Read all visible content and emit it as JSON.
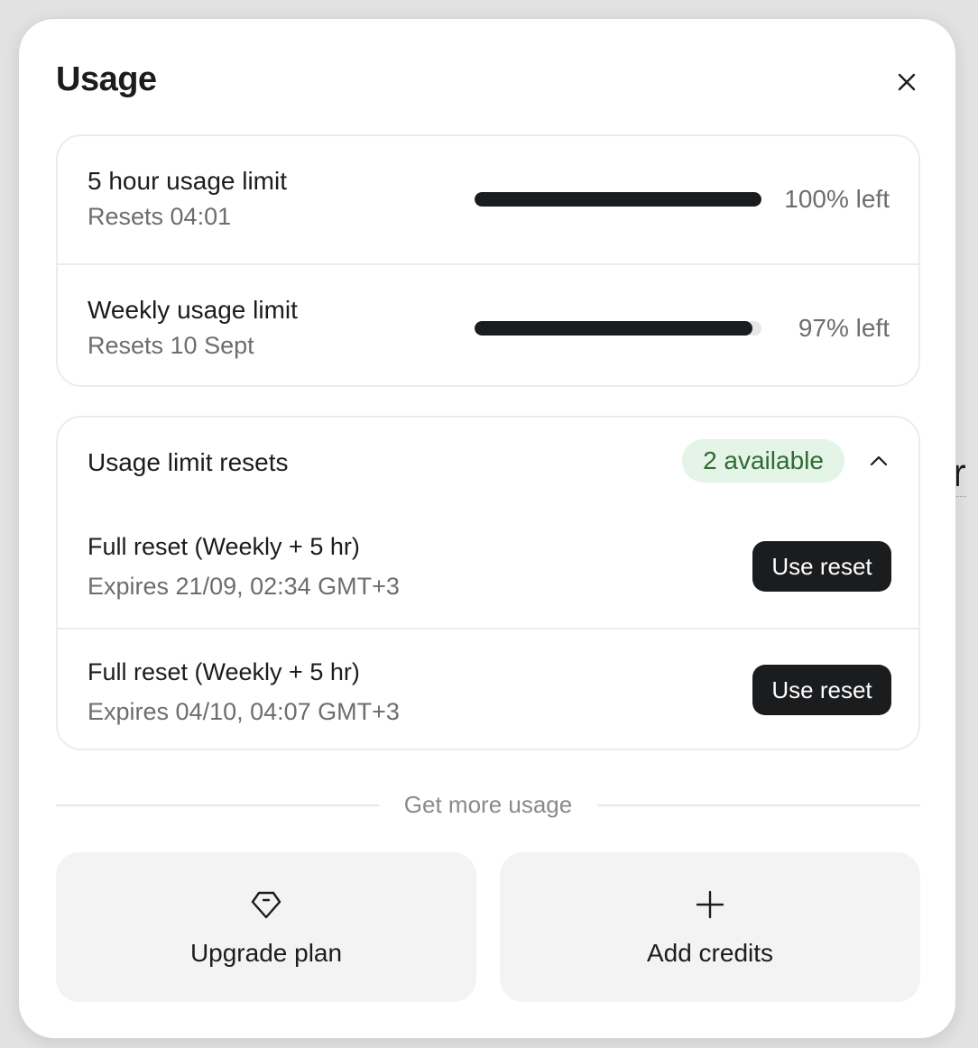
{
  "background": {
    "peek_text": "r"
  },
  "modal": {
    "title": "Usage",
    "close_icon": "close-icon"
  },
  "limits": [
    {
      "title": "5 hour usage limit",
      "reset": "Resets 04:01",
      "percent_left": 100,
      "label": "100% left"
    },
    {
      "title": "Weekly usage limit",
      "reset": "Resets 10 Sept",
      "percent_left": 97,
      "label": "97% left"
    }
  ],
  "resets": {
    "title": "Usage limit resets",
    "badge": "2 available",
    "badge_color": "#e4f4e6",
    "badge_text_color": "#2f6b35",
    "items": [
      {
        "name": "Full reset (Weekly + 5 hr)",
        "expires": "Expires 21/09, 02:34 GMT+3",
        "button": "Use reset"
      },
      {
        "name": "Full reset (Weekly + 5 hr)",
        "expires": "Expires 04/10, 04:07 GMT+3",
        "button": "Use reset"
      }
    ]
  },
  "more": {
    "divider_label": "Get more usage",
    "actions": [
      {
        "label": "Upgrade plan",
        "icon": "tag-icon"
      },
      {
        "label": "Add credits",
        "icon": "plus-icon"
      }
    ]
  }
}
